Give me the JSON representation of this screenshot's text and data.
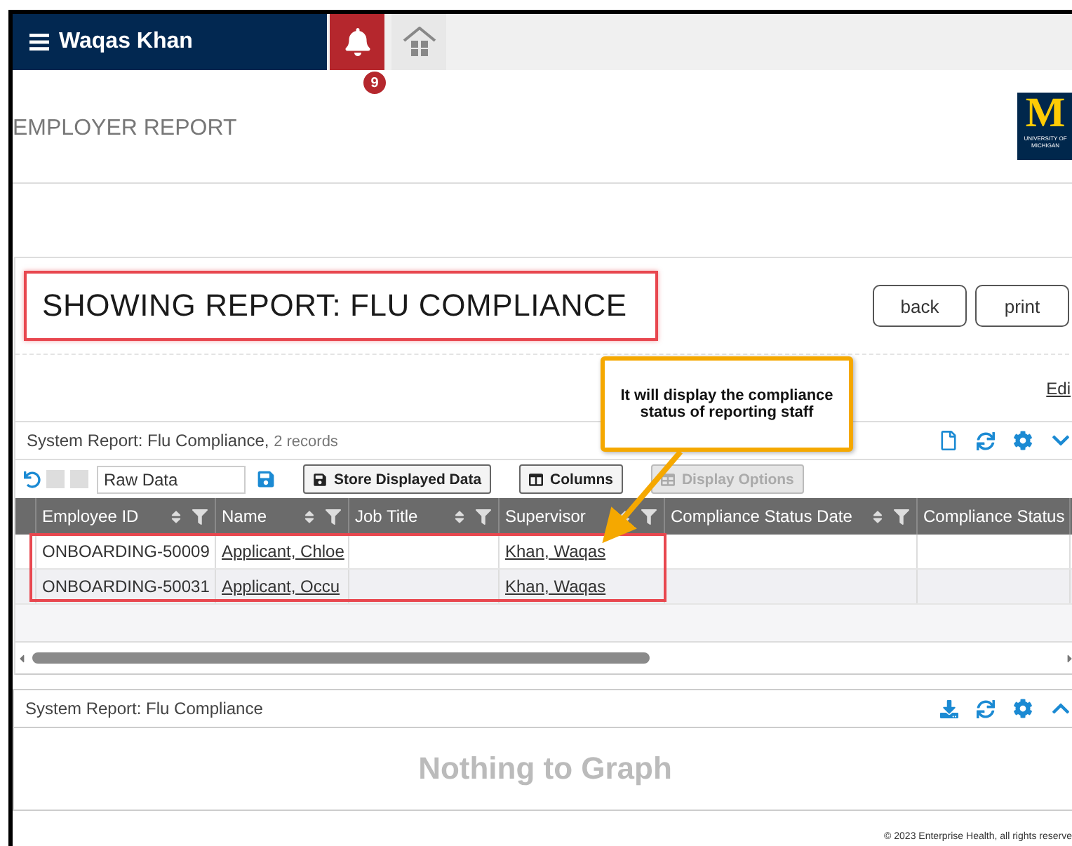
{
  "top_bar": {
    "user_name": "Waqas Khan",
    "notification_count": "9"
  },
  "page_title": "EMPLOYER REPORT",
  "logo": {
    "letter": "M",
    "lines": [
      "UNIVERSITY OF",
      "MICHIGAN"
    ]
  },
  "report": {
    "title": "SHOWING REPORT: FLU COMPLIANCE",
    "buttons": [
      "back",
      "print"
    ],
    "edit_link": "Edi"
  },
  "callout": {
    "text": "It will display the compliance status of reporting staff"
  },
  "grid": {
    "title": "System Report: Flu Compliance,",
    "count": "2 records",
    "view_name": "Raw Data",
    "toolbar": [
      {
        "label": "Store Displayed Data",
        "kind": "save",
        "disabled": false
      },
      {
        "label": "Columns",
        "kind": "columns",
        "disabled": false
      },
      {
        "label": "Display Options",
        "kind": "table",
        "disabled": true
      }
    ],
    "columns": [
      "Employee ID",
      "Name",
      "Job Title",
      "Supervisor",
      "Compliance Status Date",
      "Compliance Status"
    ],
    "rows": [
      {
        "employee_id": "ONBOARDING-50009",
        "name": "Applicant, Chloe",
        "supervisor": "Khan, Waqas"
      },
      {
        "employee_id": "ONBOARDING-50031",
        "name": "Applicant, Occu",
        "supervisor": "Khan, Waqas"
      }
    ]
  },
  "chart_panel": {
    "title": "System Report: Flu Compliance",
    "empty_message": "Nothing to Graph"
  },
  "footer": "© 2023 Enterprise Health, all rights reserve"
}
